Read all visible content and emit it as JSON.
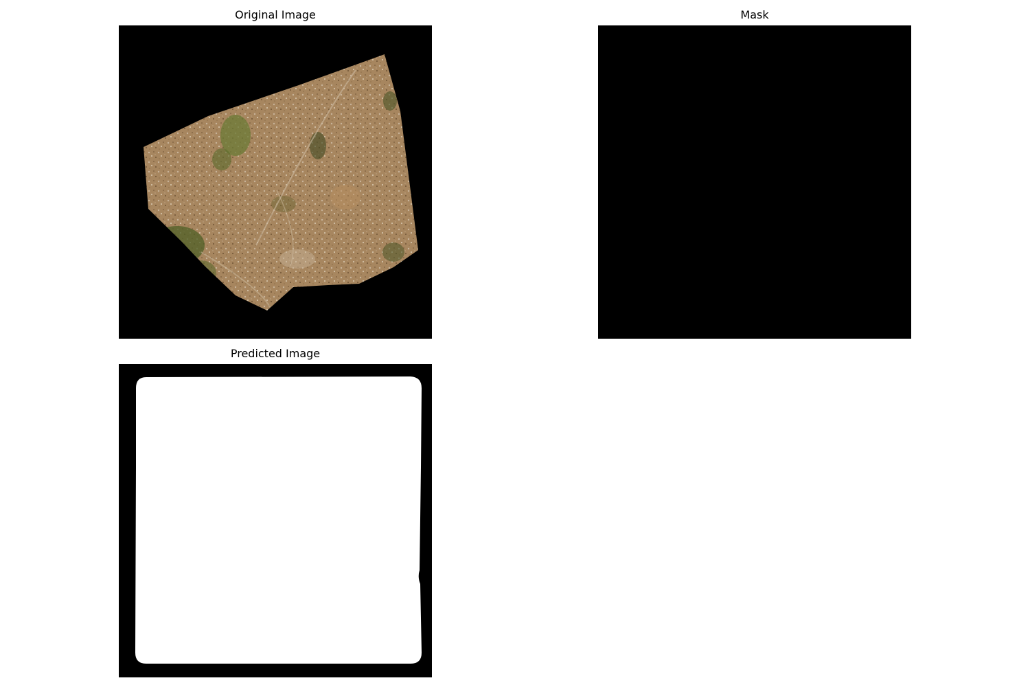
{
  "panels": {
    "original": {
      "title": "Original Image"
    },
    "mask": {
      "title": "Mask"
    },
    "predicted": {
      "title": "Predicted Image"
    }
  },
  "colors": {
    "background": "#000000",
    "figure_background": "#ffffff",
    "terrain_base": "#a88660",
    "vegetation": "#5d6a2e",
    "prediction_region": "#ffffff"
  }
}
